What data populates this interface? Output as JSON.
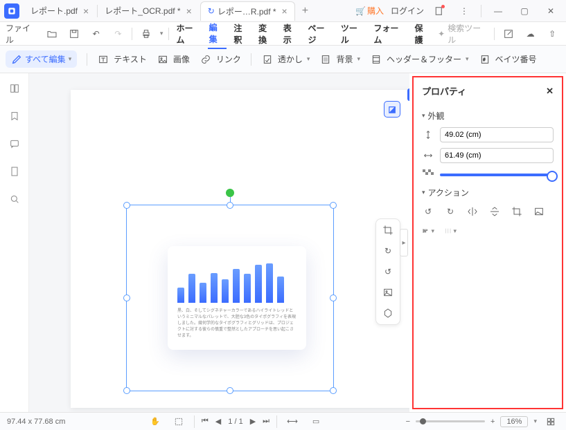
{
  "tabs": [
    {
      "label": "レポート.pdf"
    },
    {
      "label": "レポート_OCR.pdf *"
    },
    {
      "label": "レポー…R.pdf *"
    }
  ],
  "title_right": {
    "buy": "購入",
    "login": "ログイン"
  },
  "menubar": {
    "file": "ファイル",
    "items": [
      "ホーム",
      "編集",
      "注釈",
      "変換",
      "表示",
      "ページ",
      "ツール",
      "フォーム",
      "保護"
    ],
    "search": "検索ツール"
  },
  "toolbar": {
    "edit_all": "すべて編集",
    "text": "テキスト",
    "image": "画像",
    "link": "リンク",
    "watermark": "透かし",
    "background": "背景",
    "header_footer": "ヘッダー＆フッター",
    "bates": "ベイツ番号"
  },
  "card_text": "黒、白、そしてシグネチャーカラーであるハイライトレッドというミニマルなパレットで、大胆な3色のタイポグラフィを表現しました。幾何学的なタイポグラフィとグリッドは、プロジェクトに対する彼らの慎重で整然としたアプローチを思い起こさせます。",
  "chart_data": {
    "type": "bar",
    "values": [
      32,
      60,
      42,
      62,
      48,
      70,
      60,
      78,
      82,
      55
    ],
    "ylim": [
      0,
      100
    ]
  },
  "properties": {
    "title": "プロパティ",
    "appearance": "外観",
    "height": "49.02 (cm)",
    "width": "61.49 (cm)",
    "actions": "アクション"
  },
  "status": {
    "dims": "97.44 x 77.68 cm",
    "page": "1",
    "total": "1",
    "zoom": "16%"
  }
}
